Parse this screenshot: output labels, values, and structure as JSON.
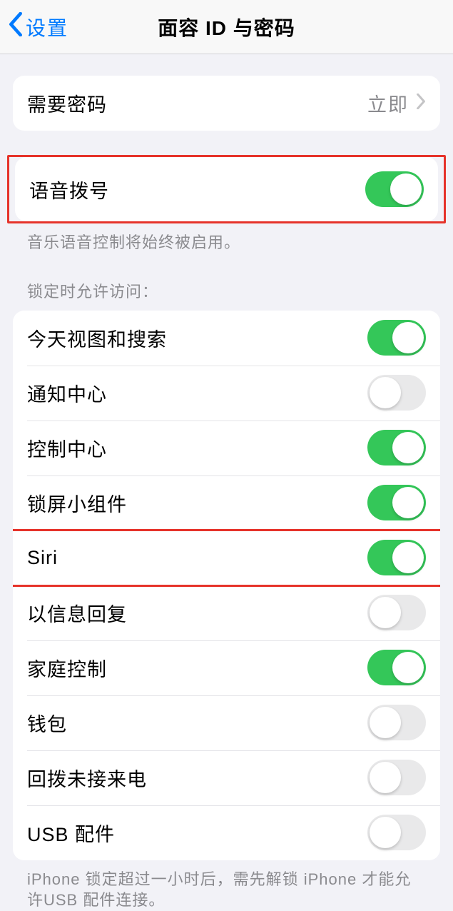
{
  "header": {
    "back_label": "设置",
    "title": "面容 ID 与密码"
  },
  "require_passcode": {
    "label": "需要密码",
    "value": "立即"
  },
  "voice_dial": {
    "label": "语音拨号",
    "footer": "音乐语音控制将始终被启用。",
    "on": true
  },
  "lock_section_header": "锁定时允许访问：",
  "lock_items": [
    {
      "label": "今天视图和搜索",
      "on": true
    },
    {
      "label": "通知中心",
      "on": false
    },
    {
      "label": "控制中心",
      "on": true
    },
    {
      "label": "锁屏小组件",
      "on": true
    },
    {
      "label": "Siri",
      "on": true
    },
    {
      "label": "以信息回复",
      "on": false
    },
    {
      "label": "家庭控制",
      "on": true
    },
    {
      "label": "钱包",
      "on": false
    },
    {
      "label": "回拨未接来电",
      "on": false
    },
    {
      "label": "USB 配件",
      "on": false
    }
  ],
  "usb_footer": "iPhone 锁定超过一小时后，需先解锁 iPhone 才能允许USB 配件连接。",
  "colors": {
    "accent": "#007aff",
    "toggle_on": "#34c759",
    "highlight": "#e6332a"
  }
}
